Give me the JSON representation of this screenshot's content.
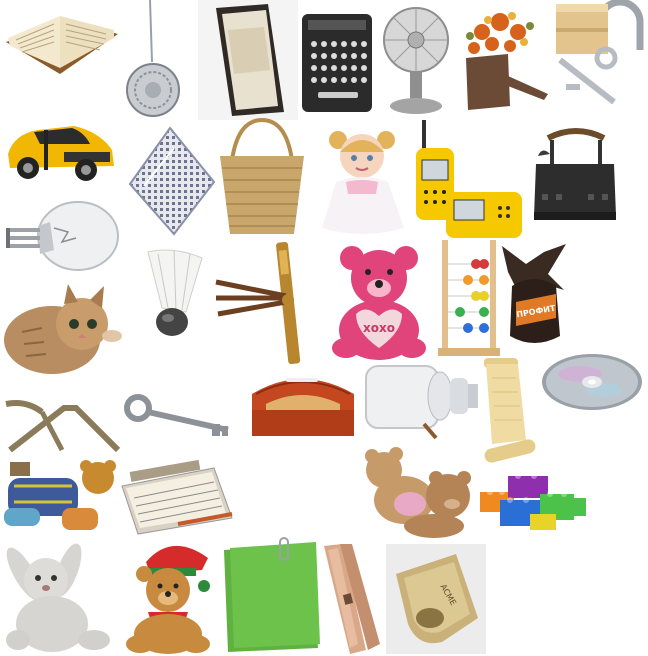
{
  "collage": {
    "background": "#ffffff",
    "objects": [
      {
        "name": "open-book-icon"
      },
      {
        "name": "pocket-watch-pendant-icon"
      },
      {
        "name": "eraser-block-icon"
      },
      {
        "name": "typewriter-icon"
      },
      {
        "name": "desk-fan-icon"
      },
      {
        "name": "flower-watering-can-icon"
      },
      {
        "name": "padlock-with-keys-icon"
      },
      {
        "name": "yellow-sports-car-icon"
      },
      {
        "name": "handkerchief-icon"
      },
      {
        "name": "wicker-basket-icon"
      },
      {
        "name": "baby-doll-icon"
      },
      {
        "name": "walkie-talkies-icon"
      },
      {
        "name": "antique-iron-icon"
      },
      {
        "name": "light-bulb-icon"
      },
      {
        "name": "shuttlecock-icon"
      },
      {
        "name": "brass-telescope-icon"
      },
      {
        "name": "pink-teddy-bear-icon"
      },
      {
        "name": "abacus-icon"
      },
      {
        "name": "wrapped-candy-icon"
      },
      {
        "name": "kitten-icon"
      },
      {
        "name": "bread-box-icon"
      },
      {
        "name": "milk-can-icon"
      },
      {
        "name": "paper-scroll-icon"
      },
      {
        "name": "compact-disc-icon"
      },
      {
        "name": "boot-jack-icon"
      },
      {
        "name": "old-key-icon"
      },
      {
        "name": "plush-teddy-icon"
      },
      {
        "name": "notepad-icon"
      },
      {
        "name": "sleeping-teddy-bears-icon"
      },
      {
        "name": "toy-blocks-icon"
      },
      {
        "name": "plush-bunny-icon"
      },
      {
        "name": "christmas-teddy-bear-icon"
      },
      {
        "name": "green-paper-with-clip-icon"
      },
      {
        "name": "stapler-icon"
      },
      {
        "name": "whistle-icon"
      }
    ],
    "labels": {
      "doll_heart": "xoxo",
      "candy_wrapper": "ПРОФИТ",
      "whistle_text": "ACME"
    },
    "colors": {
      "car_yellow": "#f2b705",
      "walkie_yellow": "#f5c800",
      "bear_pink": "#e0447a",
      "bread_box_red": "#c4471f",
      "basket_straw": "#c9a66b",
      "paper_green": "#6cc24a",
      "brass": "#b8862f"
    }
  }
}
